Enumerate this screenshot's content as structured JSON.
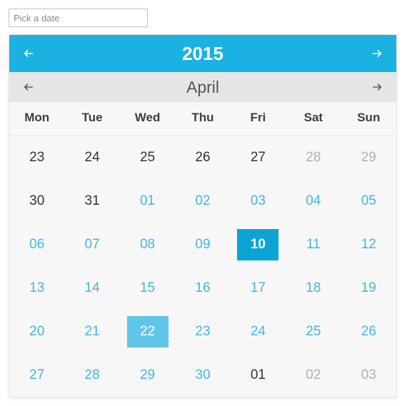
{
  "input": {
    "placeholder": "Pick a date",
    "value": ""
  },
  "year": {
    "label": "2015"
  },
  "month": {
    "label": "April"
  },
  "weekdays": [
    "Mon",
    "Tue",
    "Wed",
    "Thu",
    "Fri",
    "Sat",
    "Sun"
  ],
  "colors": {
    "accent": "#1bb1e0",
    "selected": "#0ba3d4",
    "today": "#5fc6ea"
  },
  "days": [
    {
      "n": "23",
      "kind": "prev"
    },
    {
      "n": "24",
      "kind": "prev"
    },
    {
      "n": "25",
      "kind": "prev"
    },
    {
      "n": "26",
      "kind": "prev"
    },
    {
      "n": "27",
      "kind": "prev"
    },
    {
      "n": "28",
      "kind": "other"
    },
    {
      "n": "29",
      "kind": "other"
    },
    {
      "n": "30",
      "kind": "prev"
    },
    {
      "n": "31",
      "kind": "prev"
    },
    {
      "n": "01",
      "kind": "cur"
    },
    {
      "n": "02",
      "kind": "cur"
    },
    {
      "n": "03",
      "kind": "cur"
    },
    {
      "n": "04",
      "kind": "cur"
    },
    {
      "n": "05",
      "kind": "cur"
    },
    {
      "n": "06",
      "kind": "cur"
    },
    {
      "n": "07",
      "kind": "cur"
    },
    {
      "n": "08",
      "kind": "cur"
    },
    {
      "n": "09",
      "kind": "cur"
    },
    {
      "n": "10",
      "kind": "cur",
      "selected": true
    },
    {
      "n": "11",
      "kind": "cur"
    },
    {
      "n": "12",
      "kind": "cur"
    },
    {
      "n": "13",
      "kind": "cur"
    },
    {
      "n": "14",
      "kind": "cur"
    },
    {
      "n": "15",
      "kind": "cur"
    },
    {
      "n": "16",
      "kind": "cur"
    },
    {
      "n": "17",
      "kind": "cur"
    },
    {
      "n": "18",
      "kind": "cur"
    },
    {
      "n": "19",
      "kind": "cur"
    },
    {
      "n": "20",
      "kind": "cur"
    },
    {
      "n": "21",
      "kind": "cur"
    },
    {
      "n": "22",
      "kind": "cur",
      "today": true
    },
    {
      "n": "23",
      "kind": "cur"
    },
    {
      "n": "24",
      "kind": "cur"
    },
    {
      "n": "25",
      "kind": "cur"
    },
    {
      "n": "26",
      "kind": "cur"
    },
    {
      "n": "27",
      "kind": "cur"
    },
    {
      "n": "28",
      "kind": "cur"
    },
    {
      "n": "29",
      "kind": "cur"
    },
    {
      "n": "30",
      "kind": "cur"
    },
    {
      "n": "01",
      "kind": "prev"
    },
    {
      "n": "02",
      "kind": "other"
    },
    {
      "n": "03",
      "kind": "other"
    }
  ]
}
